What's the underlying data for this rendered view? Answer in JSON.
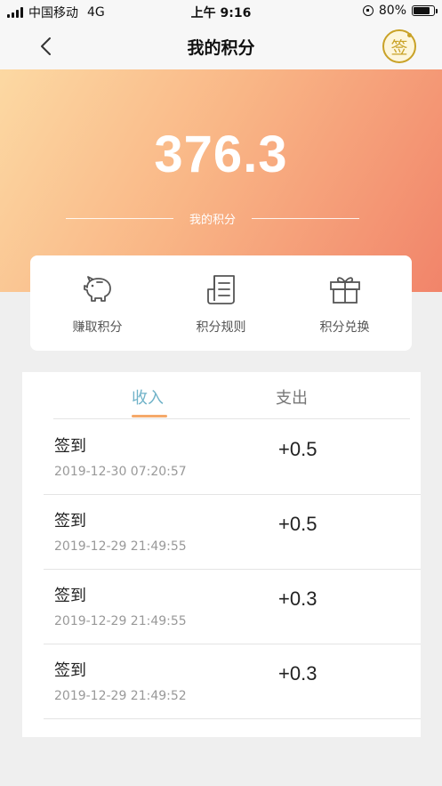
{
  "status_bar": {
    "carrier": "中国移动",
    "network": "4G",
    "time": "上午 9:16",
    "battery": "80%",
    "battery_level": 0.8
  },
  "nav": {
    "title": "我的积分",
    "sign_label": "签"
  },
  "hero": {
    "points": "376.3",
    "points_label": "我的积分"
  },
  "actions": [
    {
      "label": "赚取积分",
      "icon": "piggy-bank-icon"
    },
    {
      "label": "积分规则",
      "icon": "document-icon"
    },
    {
      "label": "积分兑换",
      "icon": "gift-icon"
    }
  ],
  "tabs": {
    "income": "收入",
    "expense": "支出",
    "active": "income"
  },
  "records": [
    {
      "title": "签到",
      "time": "2019-12-30 07:20:57",
      "amount": "+0.5"
    },
    {
      "title": "签到",
      "time": "2019-12-29 21:49:55",
      "amount": "+0.5"
    },
    {
      "title": "签到",
      "time": "2019-12-29 21:49:55",
      "amount": "+0.3"
    },
    {
      "title": "签到",
      "time": "2019-12-29 21:49:52",
      "amount": "+0.3"
    }
  ],
  "colors": {
    "accent_tab": "#6fb2c8",
    "tab_underline": "#f5a96a",
    "sign_gold": "#c9a227"
  }
}
